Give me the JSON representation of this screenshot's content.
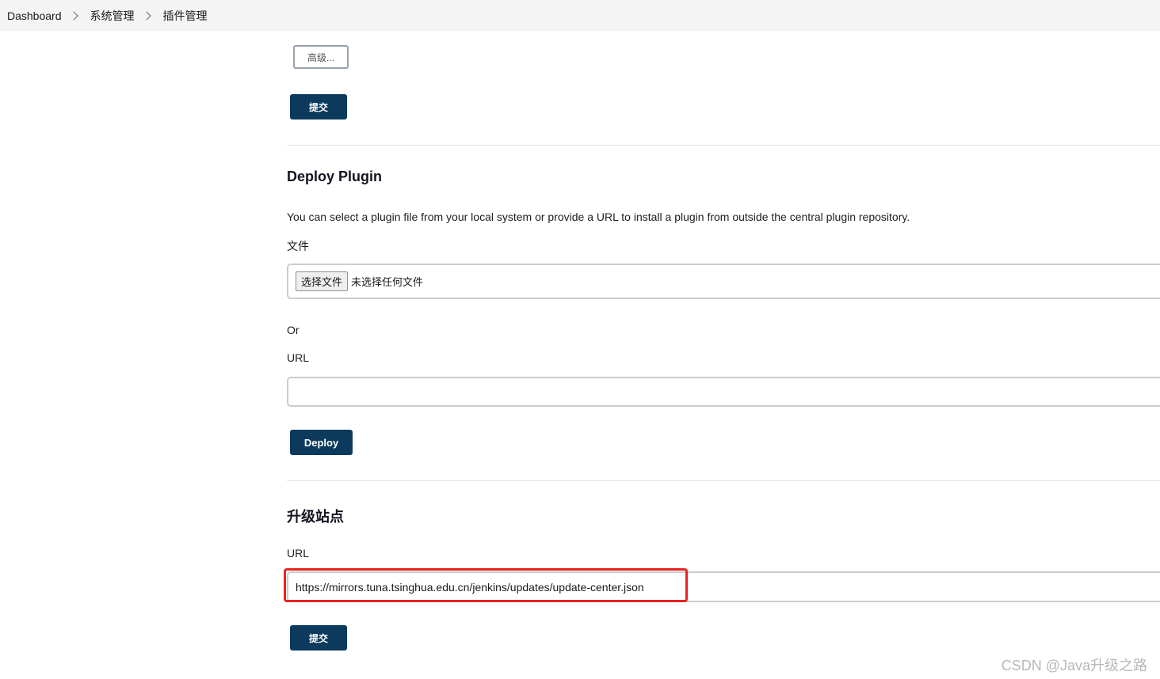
{
  "breadcrumb": {
    "items": [
      "Dashboard",
      "系统管理",
      "插件管理"
    ]
  },
  "advanced_section": {
    "advanced_button": "高级...",
    "submit_button": "提交"
  },
  "deploy_plugin": {
    "title": "Deploy Plugin",
    "description": "You can select a plugin file from your local system or provide a URL to install a plugin from outside the central plugin repository.",
    "file_label": "文件",
    "file_button": "选择文件",
    "file_status": "未选择任何文件",
    "or_label": "Or",
    "url_label": "URL",
    "url_value": "",
    "deploy_button": "Deploy"
  },
  "update_site": {
    "title": "升级站点",
    "url_label": "URL",
    "url_value": "https://mirrors.tuna.tsinghua.edu.cn/jenkins/updates/update-center.json",
    "submit_button": "提交"
  },
  "watermark": "CSDN @Java升级之路",
  "colors": {
    "primary_button": "#0b3a5c",
    "highlight_border": "#e8231f",
    "breadcrumb_bg": "#f4f4f5"
  }
}
